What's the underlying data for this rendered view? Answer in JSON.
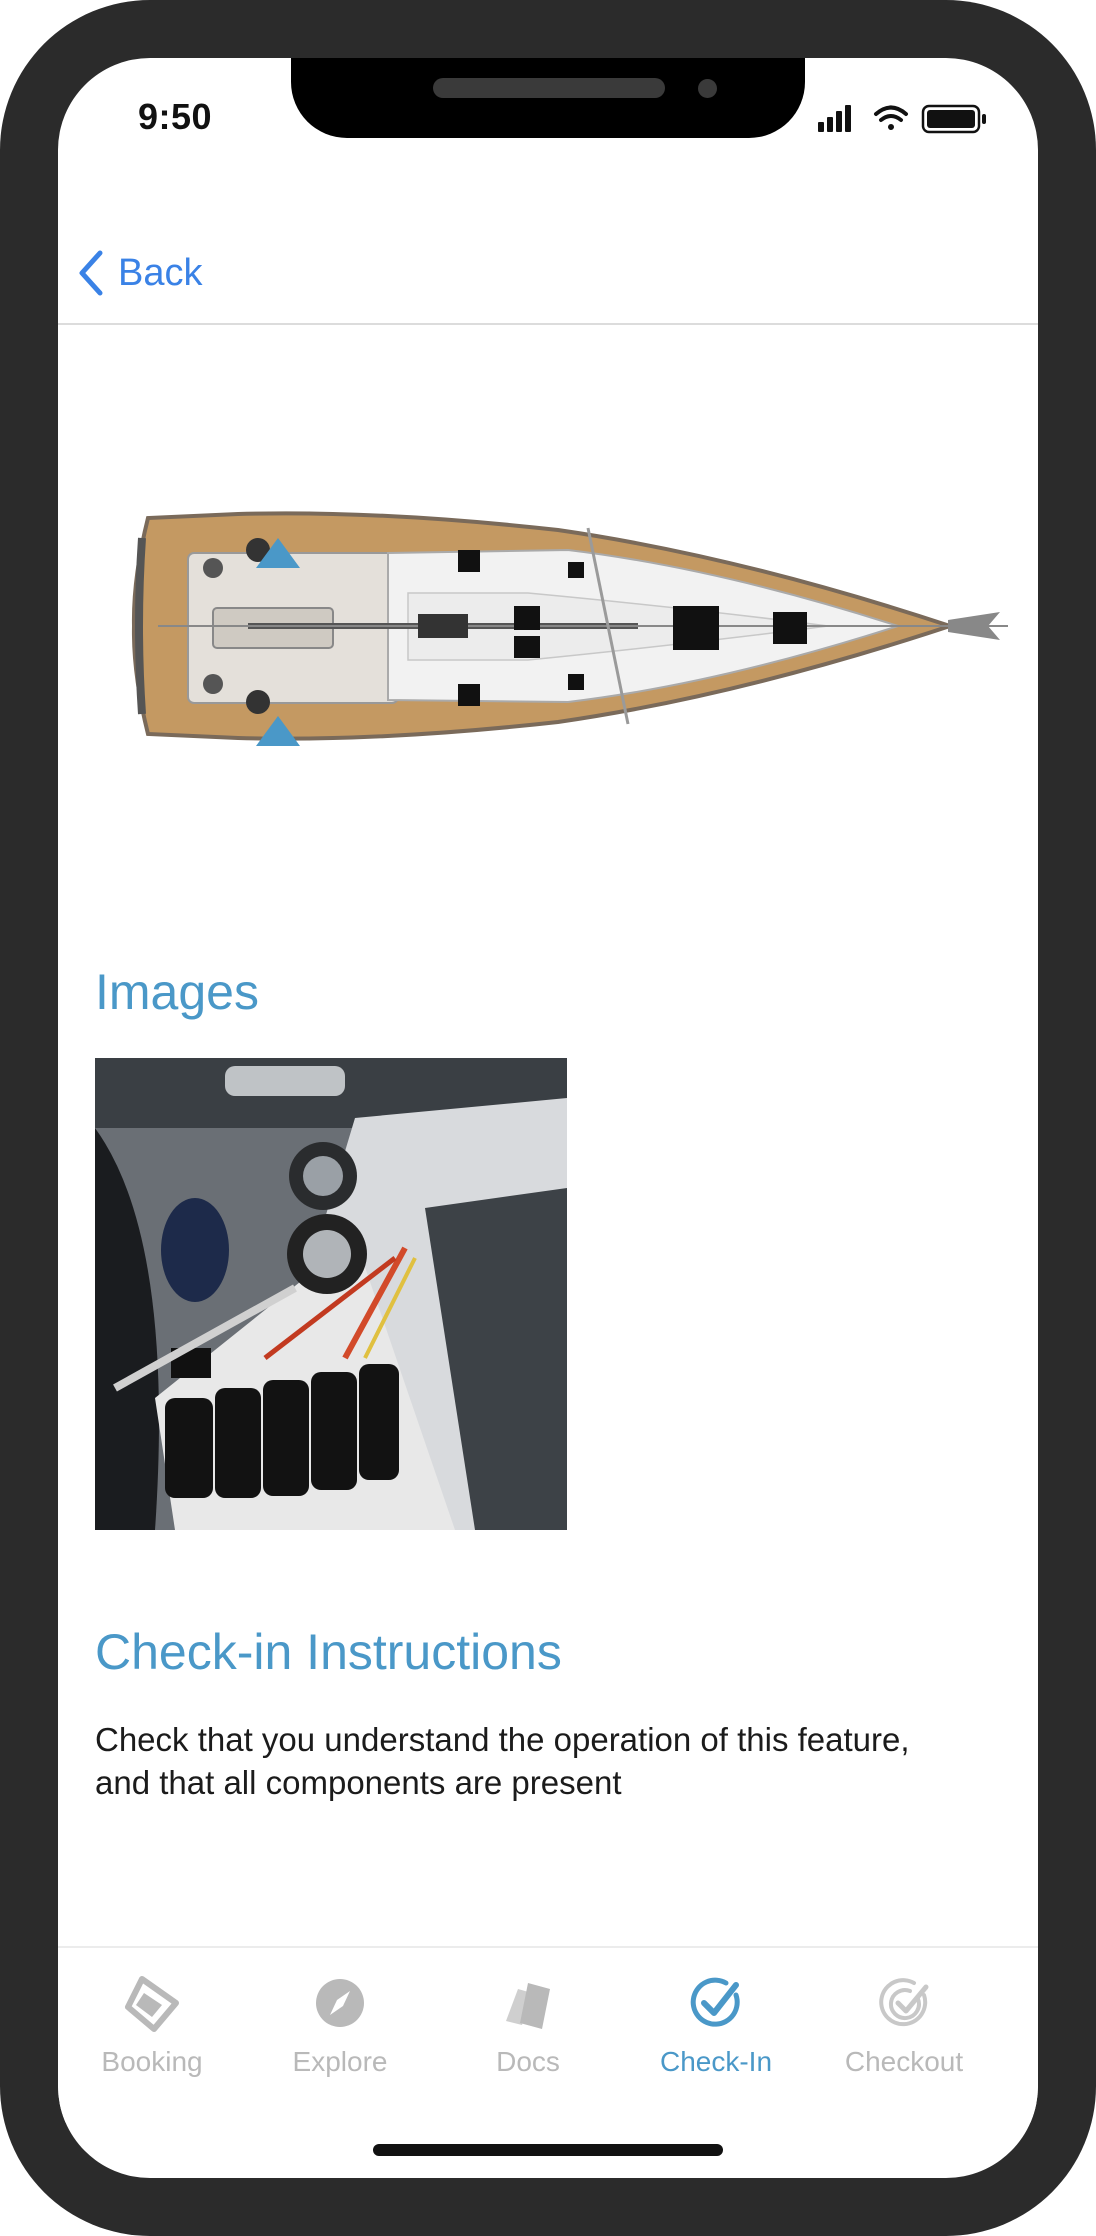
{
  "status_bar": {
    "time": "9:50"
  },
  "nav": {
    "back_label": "Back"
  },
  "diagram": {
    "icon": "boat-deck-plan"
  },
  "images_section": {
    "title": "Images",
    "photo_icon": "winch-photo"
  },
  "instructions": {
    "title": "Check-in Instructions",
    "body": "Check that you understand the operation of this feature, and that all components are present"
  },
  "tabbar": {
    "tabs": [
      {
        "label": "Booking",
        "icon": "ticket-icon"
      },
      {
        "label": "Explore",
        "icon": "compass-icon"
      },
      {
        "label": "Docs",
        "icon": "docs-icon"
      },
      {
        "label": "Check-In",
        "icon": "check-circle-icon",
        "active": true
      },
      {
        "label": "Checkout",
        "icon": "double-check-icon"
      }
    ]
  },
  "colors": {
    "accent": "#4a98c8",
    "link": "#3a82e6",
    "inactive": "#b9b9b9"
  }
}
